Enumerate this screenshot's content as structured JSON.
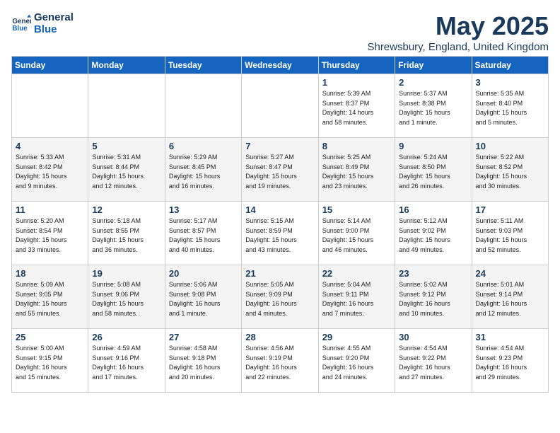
{
  "header": {
    "logo_line1": "General",
    "logo_line2": "Blue",
    "month_year": "May 2025",
    "location": "Shrewsbury, England, United Kingdom"
  },
  "days_of_week": [
    "Sunday",
    "Monday",
    "Tuesday",
    "Wednesday",
    "Thursday",
    "Friday",
    "Saturday"
  ],
  "weeks": [
    [
      {
        "day": "",
        "info": ""
      },
      {
        "day": "",
        "info": ""
      },
      {
        "day": "",
        "info": ""
      },
      {
        "day": "",
        "info": ""
      },
      {
        "day": "1",
        "info": "Sunrise: 5:39 AM\nSunset: 8:37 PM\nDaylight: 14 hours\nand 58 minutes."
      },
      {
        "day": "2",
        "info": "Sunrise: 5:37 AM\nSunset: 8:38 PM\nDaylight: 15 hours\nand 1 minute."
      },
      {
        "day": "3",
        "info": "Sunrise: 5:35 AM\nSunset: 8:40 PM\nDaylight: 15 hours\nand 5 minutes."
      }
    ],
    [
      {
        "day": "4",
        "info": "Sunrise: 5:33 AM\nSunset: 8:42 PM\nDaylight: 15 hours\nand 9 minutes."
      },
      {
        "day": "5",
        "info": "Sunrise: 5:31 AM\nSunset: 8:44 PM\nDaylight: 15 hours\nand 12 minutes."
      },
      {
        "day": "6",
        "info": "Sunrise: 5:29 AM\nSunset: 8:45 PM\nDaylight: 15 hours\nand 16 minutes."
      },
      {
        "day": "7",
        "info": "Sunrise: 5:27 AM\nSunset: 8:47 PM\nDaylight: 15 hours\nand 19 minutes."
      },
      {
        "day": "8",
        "info": "Sunrise: 5:25 AM\nSunset: 8:49 PM\nDaylight: 15 hours\nand 23 minutes."
      },
      {
        "day": "9",
        "info": "Sunrise: 5:24 AM\nSunset: 8:50 PM\nDaylight: 15 hours\nand 26 minutes."
      },
      {
        "day": "10",
        "info": "Sunrise: 5:22 AM\nSunset: 8:52 PM\nDaylight: 15 hours\nand 30 minutes."
      }
    ],
    [
      {
        "day": "11",
        "info": "Sunrise: 5:20 AM\nSunset: 8:54 PM\nDaylight: 15 hours\nand 33 minutes."
      },
      {
        "day": "12",
        "info": "Sunrise: 5:18 AM\nSunset: 8:55 PM\nDaylight: 15 hours\nand 36 minutes."
      },
      {
        "day": "13",
        "info": "Sunrise: 5:17 AM\nSunset: 8:57 PM\nDaylight: 15 hours\nand 40 minutes."
      },
      {
        "day": "14",
        "info": "Sunrise: 5:15 AM\nSunset: 8:59 PM\nDaylight: 15 hours\nand 43 minutes."
      },
      {
        "day": "15",
        "info": "Sunrise: 5:14 AM\nSunset: 9:00 PM\nDaylight: 15 hours\nand 46 minutes."
      },
      {
        "day": "16",
        "info": "Sunrise: 5:12 AM\nSunset: 9:02 PM\nDaylight: 15 hours\nand 49 minutes."
      },
      {
        "day": "17",
        "info": "Sunrise: 5:11 AM\nSunset: 9:03 PM\nDaylight: 15 hours\nand 52 minutes."
      }
    ],
    [
      {
        "day": "18",
        "info": "Sunrise: 5:09 AM\nSunset: 9:05 PM\nDaylight: 15 hours\nand 55 minutes."
      },
      {
        "day": "19",
        "info": "Sunrise: 5:08 AM\nSunset: 9:06 PM\nDaylight: 15 hours\nand 58 minutes."
      },
      {
        "day": "20",
        "info": "Sunrise: 5:06 AM\nSunset: 9:08 PM\nDaylight: 16 hours\nand 1 minute."
      },
      {
        "day": "21",
        "info": "Sunrise: 5:05 AM\nSunset: 9:09 PM\nDaylight: 16 hours\nand 4 minutes."
      },
      {
        "day": "22",
        "info": "Sunrise: 5:04 AM\nSunset: 9:11 PM\nDaylight: 16 hours\nand 7 minutes."
      },
      {
        "day": "23",
        "info": "Sunrise: 5:02 AM\nSunset: 9:12 PM\nDaylight: 16 hours\nand 10 minutes."
      },
      {
        "day": "24",
        "info": "Sunrise: 5:01 AM\nSunset: 9:14 PM\nDaylight: 16 hours\nand 12 minutes."
      }
    ],
    [
      {
        "day": "25",
        "info": "Sunrise: 5:00 AM\nSunset: 9:15 PM\nDaylight: 16 hours\nand 15 minutes."
      },
      {
        "day": "26",
        "info": "Sunrise: 4:59 AM\nSunset: 9:16 PM\nDaylight: 16 hours\nand 17 minutes."
      },
      {
        "day": "27",
        "info": "Sunrise: 4:58 AM\nSunset: 9:18 PM\nDaylight: 16 hours\nand 20 minutes."
      },
      {
        "day": "28",
        "info": "Sunrise: 4:56 AM\nSunset: 9:19 PM\nDaylight: 16 hours\nand 22 minutes."
      },
      {
        "day": "29",
        "info": "Sunrise: 4:55 AM\nSunset: 9:20 PM\nDaylight: 16 hours\nand 24 minutes."
      },
      {
        "day": "30",
        "info": "Sunrise: 4:54 AM\nSunset: 9:22 PM\nDaylight: 16 hours\nand 27 minutes."
      },
      {
        "day": "31",
        "info": "Sunrise: 4:54 AM\nSunset: 9:23 PM\nDaylight: 16 hours\nand 29 minutes."
      }
    ]
  ]
}
